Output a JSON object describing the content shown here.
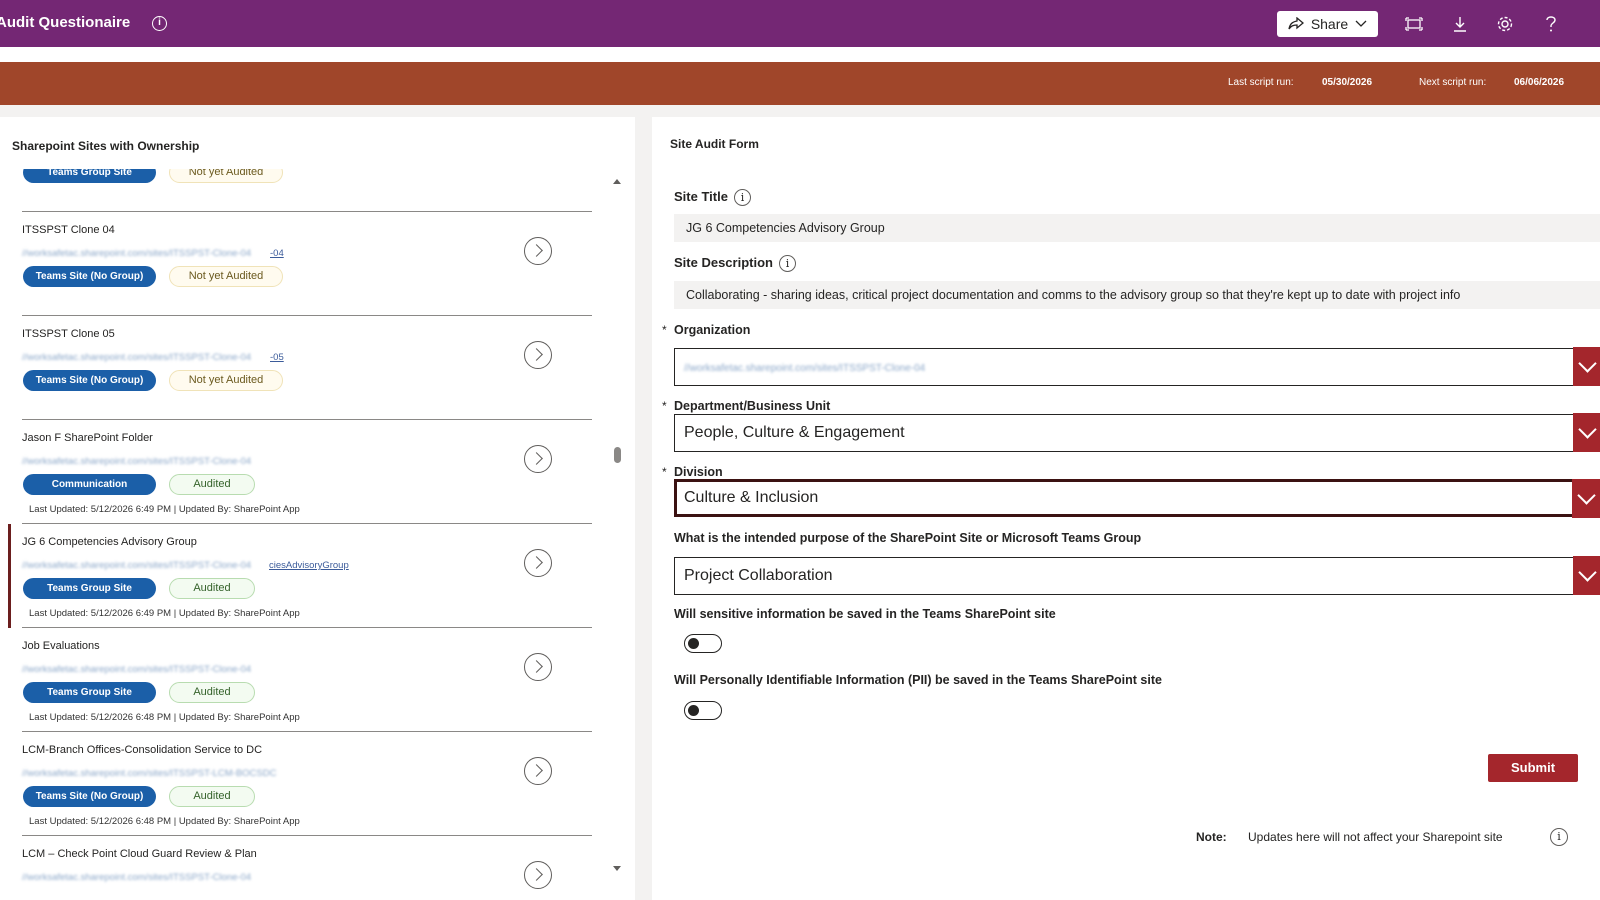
{
  "header": {
    "app_title": "Audit Questionaire",
    "share_label": "Share"
  },
  "banner": {
    "last_run_label": "Last script run:",
    "last_run_value": "05/30/2026",
    "next_run_label": "Next script run:",
    "next_run_value": "06/06/2026"
  },
  "left_panel": {
    "title": "Sharepoint Sites with Ownership",
    "items": [
      {
        "name": "",
        "url": "",
        "url_tail": "",
        "type": "Teams Group Site",
        "status": "Not yet Audited",
        "updated": "",
        "selected": false
      },
      {
        "name": "ITSSPST Clone 04",
        "url": "//worksafetac.sharepoint.com/sites/ITSSPST-Clone-04",
        "url_tail": "-04",
        "type": "Teams Site (No Group)",
        "status": "Not yet Audited",
        "updated": "",
        "selected": false
      },
      {
        "name": "ITSSPST Clone 05",
        "url": "//worksafetac.sharepoint.com/sites/ITSSPST-Clone-04",
        "url_tail": "-05",
        "type": "Teams Site (No Group)",
        "status": "Not yet Audited",
        "updated": "",
        "selected": false
      },
      {
        "name": "Jason F SharePoint Folder",
        "url": "//worksafetac.sharepoint.com/sites/ITSSPST-Clone-04",
        "url_tail": "",
        "type": "Communication",
        "status": "Audited",
        "updated": "Last Updated: 5/12/2026 6:49 PM  | Updated By: SharePoint App",
        "selected": false
      },
      {
        "name": "JG 6 Competencies Advisory Group",
        "url": "//worksafetac.sharepoint.com/sites/ITSSPST-Clone-04",
        "url_tail": "ciesAdvisoryGroup",
        "type": "Teams Group Site",
        "status": "Audited",
        "updated": "Last Updated: 5/12/2026 6:49 PM  | Updated By: SharePoint App",
        "selected": true
      },
      {
        "name": "Job Evaluations",
        "url": "//worksafetac.sharepoint.com/sites/ITSSPST-Clone-04",
        "url_tail": "",
        "type": "Teams Group Site",
        "status": "Audited",
        "updated": "Last Updated: 5/12/2026 6:48 PM  | Updated By: SharePoint App",
        "selected": false
      },
      {
        "name": "LCM-Branch Offices-Consolidation Service to DC",
        "url": "//worksafetac.sharepoint.com/sites/ITSSPST-LCM-BOCSDC",
        "url_tail": "",
        "type": "Teams Site (No Group)",
        "status": "Audited",
        "updated": "Last Updated: 5/12/2026 6:48 PM  | Updated By: SharePoint App",
        "selected": false
      },
      {
        "name": "LCM – Check Point Cloud Guard Review & Plan",
        "url": "//worksafetac.sharepoint.com/sites/ITSSPST-Clone-04",
        "url_tail": "",
        "type": "",
        "status": "",
        "updated": "",
        "selected": false
      }
    ]
  },
  "form": {
    "title": "Site Audit Form",
    "site_title_label": "Site Title",
    "site_title_value": "JG 6 Competencies Advisory Group",
    "site_desc_label": "Site Description",
    "site_desc_value": "Collaborating - sharing ideas, critical project documentation and comms to the advisory group so that they're kept up to date with project info",
    "required_mark": "*",
    "org_label": "Organization",
    "org_value": "//worksafetac.sharepoint.com/sites/ITSSPST-Clone-04",
    "dept_label": "Department/Business Unit",
    "dept_value": "People, Culture & Engagement",
    "division_label": "Division",
    "division_value": "Culture & Inclusion",
    "purpose_label": "What is the intended purpose of the SharePoint Site or Microsoft Teams Group",
    "purpose_value": "Project Collaboration",
    "sensitive_label": "Will sensitive information be saved in the Teams SharePoint site",
    "sensitive_on": false,
    "pii_label": "Will Personally Identifiable Information (PII) be saved in the Teams SharePoint site",
    "pii_on": false,
    "submit_label": "Submit",
    "note_label": "Note:",
    "note_text": "Updates here will not affect your Sharepoint site"
  },
  "colors": {
    "topbar": "#742774",
    "banner": "#a0462a",
    "accent_red": "#a4262c",
    "pill_blue": "#1b5fa8"
  }
}
